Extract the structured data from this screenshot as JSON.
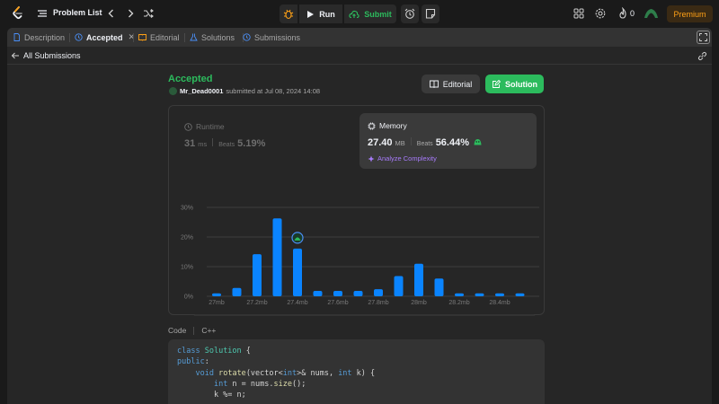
{
  "nav": {
    "problem_list_label": "Problem List",
    "run_label": "Run",
    "submit_label": "Submit",
    "streak_count": "0",
    "premium_label": "Premium"
  },
  "tabs": [
    {
      "label": "Description",
      "icon": "document-icon"
    },
    {
      "label": "Accepted",
      "icon": "history-icon",
      "active": true
    },
    {
      "label": "Editorial",
      "icon": "book-icon"
    },
    {
      "label": "Solutions",
      "icon": "flask-icon"
    },
    {
      "label": "Submissions",
      "icon": "history-icon"
    }
  ],
  "subnav": {
    "back_label": "All Submissions"
  },
  "submission": {
    "status": "Accepted",
    "username": "Mr_Dead0001",
    "submitted_text": "submitted at Jul 08, 2024 14:08",
    "editorial_label": "Editorial",
    "solution_label": "Solution"
  },
  "runtime": {
    "label": "Runtime",
    "value": "31",
    "unit": "ms",
    "beats_label": "Beats",
    "beats_value": "5.19%"
  },
  "memory": {
    "label": "Memory",
    "value": "27.40",
    "unit": "MB",
    "beats_label": "Beats",
    "beats_value": "56.44%",
    "analyze_label": "Analyze Complexity"
  },
  "colors": {
    "accent_green": "#2cbb5d",
    "bar_blue": "#0a84ff",
    "premium": "#ffa116",
    "purple": "#a77bfa"
  },
  "chart_data": {
    "type": "bar",
    "ytick_labels": [
      "30%",
      "20%",
      "10%",
      "0%"
    ],
    "ylim": [
      0,
      30
    ],
    "xtick_labels": [
      "27mb",
      "27.2mb",
      "27.4mb",
      "27.6mb",
      "27.8mb",
      "28mb",
      "28.2mb",
      "28.4mb"
    ],
    "x": [
      27.0,
      27.1,
      27.2,
      27.3,
      27.4,
      27.5,
      27.6,
      27.7,
      27.8,
      27.9,
      28.0,
      28.1,
      28.2,
      28.3,
      28.4,
      28.5
    ],
    "values": [
      1.0,
      2.8,
      14.2,
      26.3,
      16.1,
      1.8,
      1.8,
      1.8,
      2.4,
      6.8,
      11.0,
      6.0,
      1.0,
      1.0,
      1.0,
      1.0
    ],
    "highlight_x": 27.4,
    "grid": true
  },
  "code": {
    "header_label": "Code",
    "language": "C++",
    "lines": [
      [
        {
          "t": "class ",
          "c": "kw"
        },
        {
          "t": "Solution",
          "c": "ty"
        },
        {
          "t": " {",
          "c": ""
        }
      ],
      [
        {
          "t": "public",
          "c": "kw"
        },
        {
          "t": ":",
          "c": ""
        }
      ],
      [
        {
          "t": "    ",
          "c": ""
        },
        {
          "t": "void",
          "c": "kw"
        },
        {
          "t": " ",
          "c": ""
        },
        {
          "t": "rotate",
          "c": "fn"
        },
        {
          "t": "(vector<",
          "c": ""
        },
        {
          "t": "int",
          "c": "kw"
        },
        {
          "t": ">& nums, ",
          "c": ""
        },
        {
          "t": "int",
          "c": "kw"
        },
        {
          "t": " k) {",
          "c": ""
        }
      ],
      [
        {
          "t": "        ",
          "c": ""
        },
        {
          "t": "int",
          "c": "kw"
        },
        {
          "t": " n = nums.",
          "c": ""
        },
        {
          "t": "size",
          "c": "fn"
        },
        {
          "t": "();",
          "c": ""
        }
      ],
      [
        {
          "t": "        k %= n;",
          "c": ""
        }
      ]
    ]
  }
}
